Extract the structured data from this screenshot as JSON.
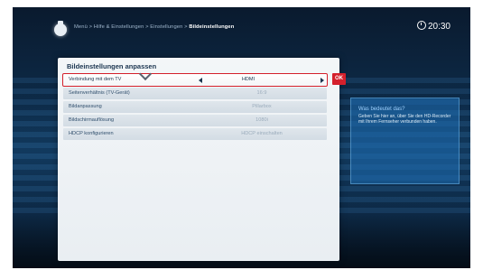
{
  "header": {
    "breadcrumb_path": "Menü > Hilfe & Einstellungen > Einstellungen > ",
    "breadcrumb_current": "Bildeinstellungen",
    "clock": "20:30"
  },
  "panel": {
    "title": "Bildeinstellungen anpassen",
    "rows": [
      {
        "label": "Verbindung mit dem TV",
        "value": "HDMI",
        "selected": true
      },
      {
        "label": "Seitenverhältnis (TV-Gerät)",
        "value": "16:9"
      },
      {
        "label": "Bildanpassung",
        "value": "Pillarbox"
      },
      {
        "label": "Bildschirmauflösung",
        "value": "1080i"
      },
      {
        "label": "HDCP konfigurieren",
        "value": "HDCP einschalten"
      }
    ],
    "ok_label": "OK"
  },
  "info": {
    "title": "Was bedeutet das?",
    "text": "Geben Sie hier an, über Sie den HD-Recorder mit Ihrem Fernseher verbunden haben."
  },
  "colors": {
    "accent_red": "#d4202c",
    "panel_bg": "#f3f6f8",
    "info_bg": "#1e6eb4"
  },
  "icons": {
    "home": "home-icon",
    "clock": "clock-icon",
    "chevron": "chevron-down-icon"
  }
}
